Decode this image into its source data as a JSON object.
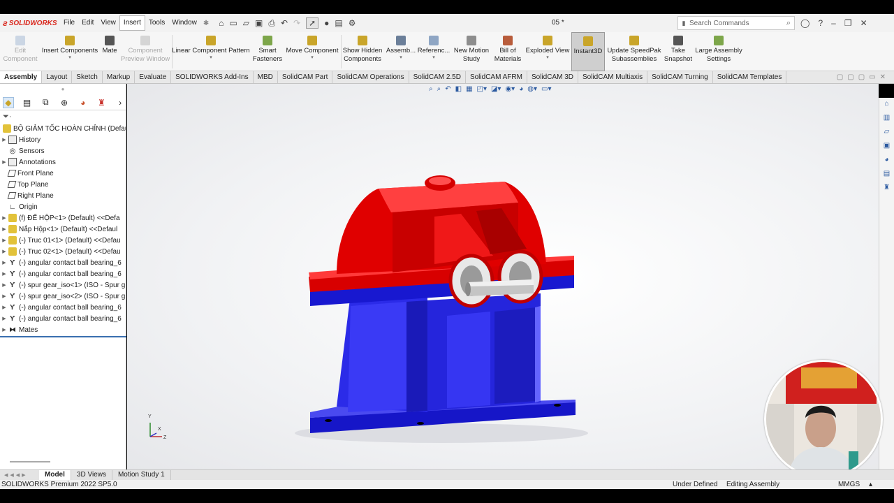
{
  "app": {
    "brand": "SOLIDWORKS",
    "doc_title": "05 *"
  },
  "menu": [
    "File",
    "Edit",
    "View",
    "Insert",
    "Tools",
    "Window"
  ],
  "search": {
    "placeholder": "Search Commands"
  },
  "ribbon": {
    "edit_component": [
      "Edit",
      "Component"
    ],
    "insert_components": "Insert Components",
    "mate": "Mate",
    "component_preview": [
      "Component",
      "Preview Window"
    ],
    "linear_pattern": "Linear Component Pattern",
    "smart_fasteners": [
      "Smart",
      "Fasteners"
    ],
    "move_component": "Move Component",
    "show_hidden": [
      "Show Hidden",
      "Components"
    ],
    "assembly": "Assemb...",
    "reference": "Referenc...",
    "motion_study": [
      "New Motion",
      "Study"
    ],
    "bom": [
      "Bill of",
      "Materials"
    ],
    "exploded_view": "Exploded View",
    "instant3d": "Instant3D",
    "speedpak": [
      "Update SpeedPak",
      "Subassemblies"
    ],
    "snapshot": [
      "Take",
      "Snapshot"
    ],
    "large_assembly": [
      "Large Assembly",
      "Settings"
    ]
  },
  "tabs": [
    "Assembly",
    "Layout",
    "Sketch",
    "Markup",
    "Evaluate",
    "SOLIDWORKS Add-Ins",
    "MBD",
    "SolidCAM Part",
    "SolidCAM Operations",
    "SolidCAM 2.5D",
    "SolidCAM AFRM",
    "SolidCAM 3D",
    "SolidCAM Multiaxis",
    "SolidCAM Turning",
    "SolidCAM Templates"
  ],
  "tree": {
    "root": "BỘ GIẢM TỐC HOÀN CHỈNH (Default",
    "items": [
      {
        "label": "History",
        "icon": "history-icon"
      },
      {
        "label": "Sensors",
        "icon": "sensor-icon"
      },
      {
        "label": "Annotations",
        "icon": "annotation-icon"
      },
      {
        "label": "Front Plane",
        "icon": "plane-icon"
      },
      {
        "label": "Top Plane",
        "icon": "plane-icon"
      },
      {
        "label": "Right Plane",
        "icon": "plane-icon"
      },
      {
        "label": "Origin",
        "icon": "origin-icon"
      },
      {
        "label": "(f) ĐẾ HỘP<1> (Default) <<Defa",
        "icon": "part-icon"
      },
      {
        "label": "Nắp Hộp<1> (Default) <<Defaul",
        "icon": "part-icon"
      },
      {
        "label": "(-) Truc 01<1> (Default) <<Defau",
        "icon": "part-icon"
      },
      {
        "label": "(-) Truc 02<1> (Default) <<Defau",
        "icon": "part-icon"
      },
      {
        "label": "(-) angular contact ball bearing_6",
        "icon": "toolbox-icon"
      },
      {
        "label": "(-) angular contact ball bearing_6",
        "icon": "toolbox-icon"
      },
      {
        "label": "(-) spur gear_iso<1> (ISO - Spur g",
        "icon": "toolbox-icon"
      },
      {
        "label": "(-) spur gear_iso<2> (ISO - Spur g",
        "icon": "toolbox-icon"
      },
      {
        "label": "(-) angular contact ball bearing_6",
        "icon": "toolbox-icon"
      },
      {
        "label": "(-) angular contact ball bearing_6",
        "icon": "toolbox-icon"
      },
      {
        "label": "Mates",
        "icon": "mates-icon"
      }
    ]
  },
  "axes": {
    "x": "X",
    "y": "Y",
    "z": "Z"
  },
  "bottom_tabs": [
    "Model",
    "3D Views",
    "Motion Study 1"
  ],
  "status": {
    "version": "SOLIDWORKS Premium 2022 SP5.0",
    "defined": "Under Defined",
    "mode": "Editing Assembly",
    "units": "MMGS"
  },
  "colors": {
    "housing_top": "#e60000",
    "housing_base": "#2222e6",
    "brand": "#d9261c"
  }
}
